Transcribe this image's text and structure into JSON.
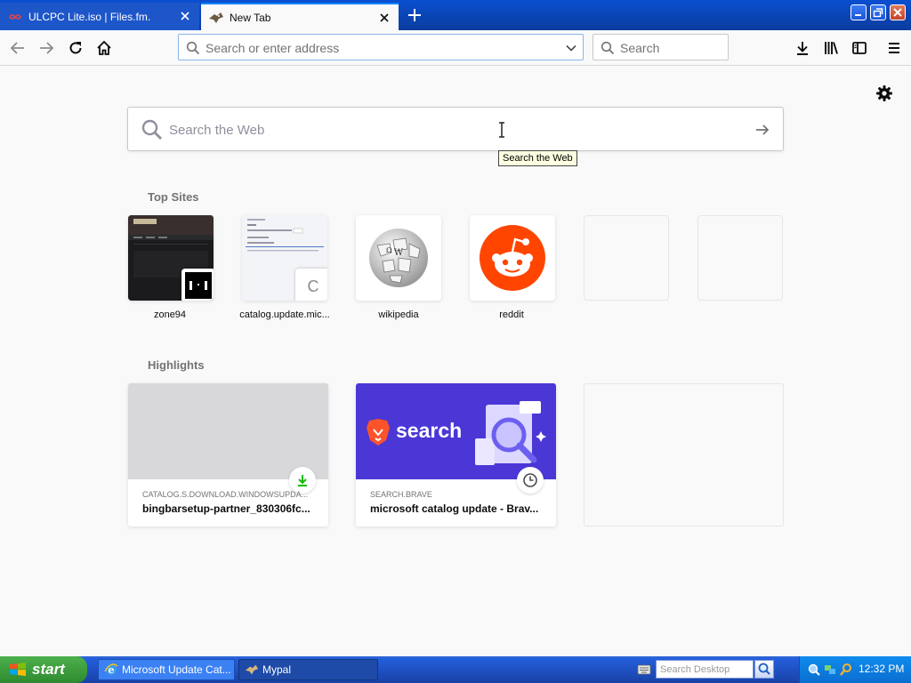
{
  "tabs": [
    {
      "title": "ULCPC Lite.iso | Files.fm.",
      "icon": "files-fm-icon",
      "active": false
    },
    {
      "title": "New Tab",
      "icon": "mypal-icon",
      "active": true
    }
  ],
  "navbar": {
    "url_placeholder": "Search or enter address",
    "search_placeholder": "Search"
  },
  "newtab": {
    "web_search_placeholder": "Search the Web",
    "tooltip": "Search the Web",
    "top_sites_title": "Top Sites",
    "top_sites": [
      {
        "label": "zone94",
        "icon": "zone94-thumbnail"
      },
      {
        "label": "catalog.update.mic...",
        "icon": "catalog-thumbnail",
        "letter": "C"
      },
      {
        "label": "wikipedia",
        "icon": "wikipedia-globe-icon"
      },
      {
        "label": "reddit",
        "icon": "reddit-icon"
      }
    ],
    "highlights_title": "Highlights",
    "highlights": [
      {
        "source": "CATALOG.S.DOWNLOAD.WINDOWSUPDA...",
        "title": "bingbarsetup-partner_830306fc...",
        "badge": "download-icon"
      },
      {
        "source": "SEARCH.BRAVE",
        "title": "microsoft catalog update - Brav...",
        "badge": "clock-icon",
        "image_text": "search"
      }
    ]
  },
  "taskbar": {
    "start_label": "start",
    "tasks": [
      {
        "label": "Microsoft Update Cat...",
        "icon": "ie-icon"
      },
      {
        "label": "Mypal",
        "icon": "mypal-icon"
      }
    ],
    "desktop_search_placeholder": "Search Desktop",
    "clock": "12:32 PM"
  },
  "colors": {
    "accent": "#0a84ff",
    "reddit": "#ff4500",
    "brave_purple": "#4b37d6",
    "download_green": "#12bc00"
  }
}
